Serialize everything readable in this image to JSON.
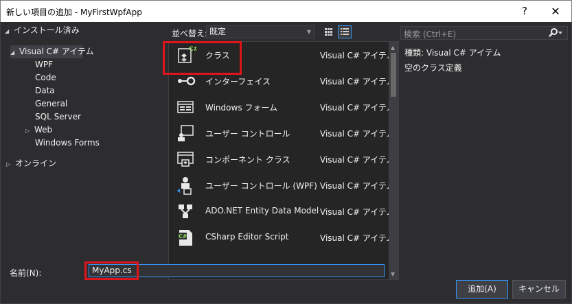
{
  "window": {
    "title": "新しい項目の追加 - MyFirstWpfApp",
    "help": "?",
    "close": "✕"
  },
  "tree": {
    "installed": "インストール済み",
    "csharp": "Visual C# アイテム",
    "children": [
      "WPF",
      "Code",
      "Data",
      "General",
      "SQL Server",
      "Web",
      "Windows Forms"
    ],
    "online": "オンライン"
  },
  "sort": {
    "label": "並べ替え:",
    "value": "既定"
  },
  "search": {
    "placeholder": "検索 (Ctrl+E)"
  },
  "items": [
    {
      "name": "クラス",
      "category": "Visual C# アイテム",
      "icon": "class-icon"
    },
    {
      "name": "インターフェイス",
      "category": "Visual C# アイテム",
      "icon": "interface-icon"
    },
    {
      "name": "Windows フォーム",
      "category": "Visual C# アイテム",
      "icon": "windows-form-icon"
    },
    {
      "name": "ユーザー コントロール",
      "category": "Visual C# アイテム",
      "icon": "user-control-icon"
    },
    {
      "name": "コンポーネント クラス",
      "category": "Visual C# アイテム",
      "icon": "component-class-icon"
    },
    {
      "name": "ユーザー コントロール (WPF)",
      "category": "Visual C# アイテム",
      "icon": "wpf-user-control-icon"
    },
    {
      "name": "ADO.NET Entity Data Model",
      "category": "Visual C# アイテム",
      "icon": "entity-data-model-icon"
    },
    {
      "name": "CSharp Editor Script",
      "category": "Visual C# アイテム",
      "icon": "csharp-script-icon"
    }
  ],
  "details": {
    "type_label": "種類:",
    "type_value": "Visual C# アイテム",
    "description": "空のクラス定義"
  },
  "name": {
    "label": "名前(N):",
    "value": "MyApp.cs"
  },
  "buttons": {
    "add": "追加(A)",
    "cancel": "キャンセル"
  },
  "colors": {
    "background": "#2d2d30",
    "list_background": "#252526",
    "accent": "#3399ff",
    "highlight": "#e0141b"
  }
}
